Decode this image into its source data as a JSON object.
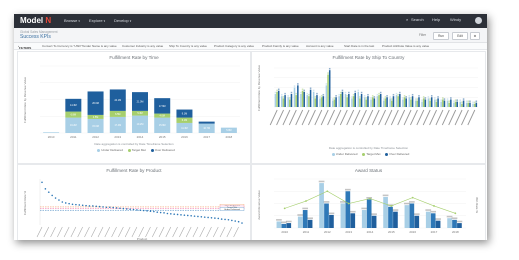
{
  "app": {
    "logo_text": "Model",
    "logo_accent": "N"
  },
  "nav": {
    "items": [
      {
        "label": "Browse"
      },
      {
        "label": "Explore"
      },
      {
        "label": "Develop"
      }
    ]
  },
  "topbar_right": {
    "search": "Search",
    "help": "Help",
    "user": "Windy"
  },
  "page": {
    "breadcrumb": "Global Sales Management",
    "title": "Success KPIs"
  },
  "subbar": {
    "filter_label": "Filter",
    "run_label": "Run",
    "edit_label": "Edit"
  },
  "filters": {
    "toggle": "FILTERS",
    "items": [
      "Convert To Currency is \"USD\"",
      "Tender Name is any value",
      "Customer Industry is any value",
      "Ship To Country is any value",
      "Product Category is any value",
      "Product Family is any value",
      "Account is any value",
      "Start Date is in the last",
      "Product Attribute Value is any value"
    ]
  },
  "colors": {
    "under": "#a8cfe6",
    "target": "#a6cf6e",
    "over": "#1f5f9d",
    "mid": "#2e78b7",
    "pink": "#f0609e",
    "orange": "#ef8a4a"
  },
  "panels": {
    "p1": {
      "title": "Fulfillment Rate by Time",
      "note": "Date aggregation is controlled by Date Timeframe Selection",
      "ylabel": "Fulfillment Rate by Revenue Value"
    },
    "p2": {
      "title": "Fulfillment Rate by Ship To Country",
      "note": "Date aggregation is controlled by Date Timeframe Selection",
      "ylabel": "Fulfillment Rate by Revenue Value"
    },
    "p3": {
      "title": "Fulfillment Rate by Product",
      "ylabel": "Fulfillment Rate %",
      "xlabel": "Product",
      "ref_labels": [
        "Over Delivered",
        "Target Met",
        "Under Delivered"
      ]
    },
    "p4": {
      "title": "Award Status",
      "ylabel": "Award Revenue Value",
      "y2label": "Win Rate %"
    }
  },
  "legend": {
    "under": "Under Delivered",
    "target": "Target Met",
    "over": "Over Delivered"
  },
  "chart_data": [
    {
      "type": "bar",
      "title": "Fulfillment Rate by Time",
      "categories": [
        "2010",
        "2011",
        "2012",
        "2013",
        "2014",
        "2015",
        "2016",
        "2017",
        "2018"
      ],
      "series": [
        {
          "name": "Under Delivered",
          "values": [
            1,
            23,
            21,
            24,
            26,
            23,
            15,
            14,
            8
          ]
        },
        {
          "name": "Target Met",
          "values": [
            0,
            9,
            6,
            9,
            7,
            6,
            8,
            0,
            0
          ]
        },
        {
          "name": "Over Delivered",
          "values": [
            0,
            19,
            35,
            32,
            28,
            23,
            12,
            3,
            0
          ]
        }
      ],
      "labels": [
        [
          "",
          "16.2M",
          "15.6M",
          "17.4M",
          "19.2M",
          "15.9M",
          "11.3M",
          "10.7M",
          "5.8M"
        ],
        [
          "",
          "6.8M",
          "4.5M",
          "6.5M",
          "5.3M",
          "4.6M",
          "6.1M",
          "",
          ""
        ],
        [
          "",
          "14.3M",
          "26.6M",
          "24.1M",
          "21.0M",
          "17.6M",
          "9.1M",
          "2.1M",
          ""
        ]
      ]
    },
    {
      "type": "bar",
      "title": "Fulfillment Rate by Ship To Country",
      "n_categories": 32,
      "series": [
        {
          "name": "Under Delivered",
          "values": [
            12,
            10,
            9,
            18,
            12,
            11,
            14,
            8,
            20,
            6,
            10,
            12,
            8,
            14,
            9,
            7,
            10,
            6,
            8,
            11,
            7,
            9,
            6,
            5,
            8,
            7,
            5,
            6,
            4,
            5,
            4,
            3
          ]
        },
        {
          "name": "Target Met",
          "values": [
            14,
            8,
            7,
            11,
            15,
            10,
            8,
            9,
            30,
            7,
            12,
            9,
            10,
            8,
            7,
            9,
            11,
            8,
            6,
            10,
            9,
            7,
            6,
            8,
            6,
            5,
            7,
            4,
            5,
            3,
            4,
            3
          ]
        },
        {
          "name": "Over Delivered",
          "values": [
            15,
            11,
            12,
            20,
            14,
            16,
            11,
            10,
            34,
            9,
            14,
            12,
            13,
            12,
            10,
            8,
            12,
            9,
            10,
            12,
            8,
            10,
            9,
            7,
            9,
            8,
            6,
            7,
            5,
            6,
            4,
            4
          ]
        }
      ]
    },
    {
      "type": "scatter",
      "title": "Fulfillment Rate by Product",
      "reference_lines": {
        "Over Delivered": 105,
        "Target Met": 100,
        "Under Delivered": 95
      },
      "points_desc": "declining curve",
      "values": [
        180,
        160,
        150,
        140,
        132,
        126,
        120,
        117,
        115,
        113,
        112,
        111,
        110,
        109,
        108,
        108,
        107,
        106,
        105,
        104,
        104,
        103,
        102,
        101,
        100,
        99,
        98,
        97,
        96,
        95,
        94,
        93,
        92,
        91,
        89,
        88,
        87,
        85,
        84,
        83,
        82,
        81,
        80,
        79,
        78,
        77,
        76,
        75,
        74,
        73,
        72,
        71,
        70,
        68,
        67,
        66,
        64,
        62,
        60,
        56
      ]
    },
    {
      "type": "bar",
      "title": "Award Status",
      "categories": [
        "2010",
        "2011",
        "2012",
        "2013",
        "2014",
        "2015",
        "2016",
        "2017",
        "2018"
      ],
      "series": [
        {
          "name": "Awarded",
          "values": [
            8,
            14,
            55,
            30,
            22,
            38,
            28,
            20,
            12
          ]
        },
        {
          "name": "Bid",
          "values": [
            5,
            22,
            30,
            45,
            35,
            26,
            30,
            18,
            10
          ]
        },
        {
          "name": "Other",
          "values": [
            6,
            10,
            16,
            18,
            15,
            20,
            15,
            9,
            6
          ]
        }
      ],
      "win_rate": [
        40,
        55,
        75,
        50,
        60,
        45,
        62,
        45,
        30
      ]
    }
  ]
}
